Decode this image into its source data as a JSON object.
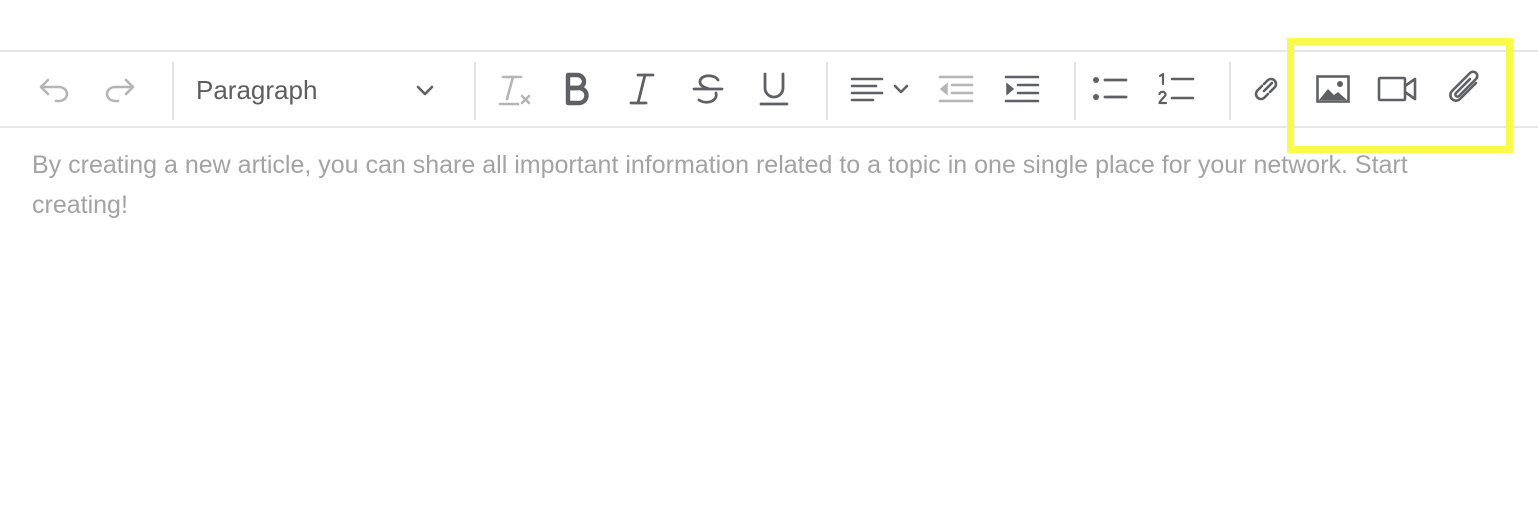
{
  "toolbar": {
    "paragraph_select": {
      "value": "Paragraph"
    },
    "icons": {
      "undo": "undo-icon",
      "redo": "redo-icon",
      "clear_format": "clear-formatting-icon",
      "bold": "bold-icon",
      "italic": "italic-icon",
      "strikethrough": "strikethrough-icon",
      "underline": "underline-icon",
      "align": "align-left-icon",
      "outdent": "outdent-icon",
      "indent": "indent-icon",
      "bullet_list": "bulleted-list-icon",
      "numbered_list": "numbered-list-icon",
      "link": "link-icon",
      "image": "image-icon",
      "video": "video-icon",
      "attachment": "paperclip-icon"
    },
    "highlighted_group": [
      "image",
      "video",
      "attachment"
    ],
    "colors": {
      "icon": "#5f6066",
      "icon_disabled": "#b5b5b8",
      "highlight": "#fbf94a",
      "divider": "#e6e6e6"
    }
  },
  "editor": {
    "placeholder": "By creating a new article, you can share all important information related to a topic in one single place for your network. Start creating!"
  }
}
